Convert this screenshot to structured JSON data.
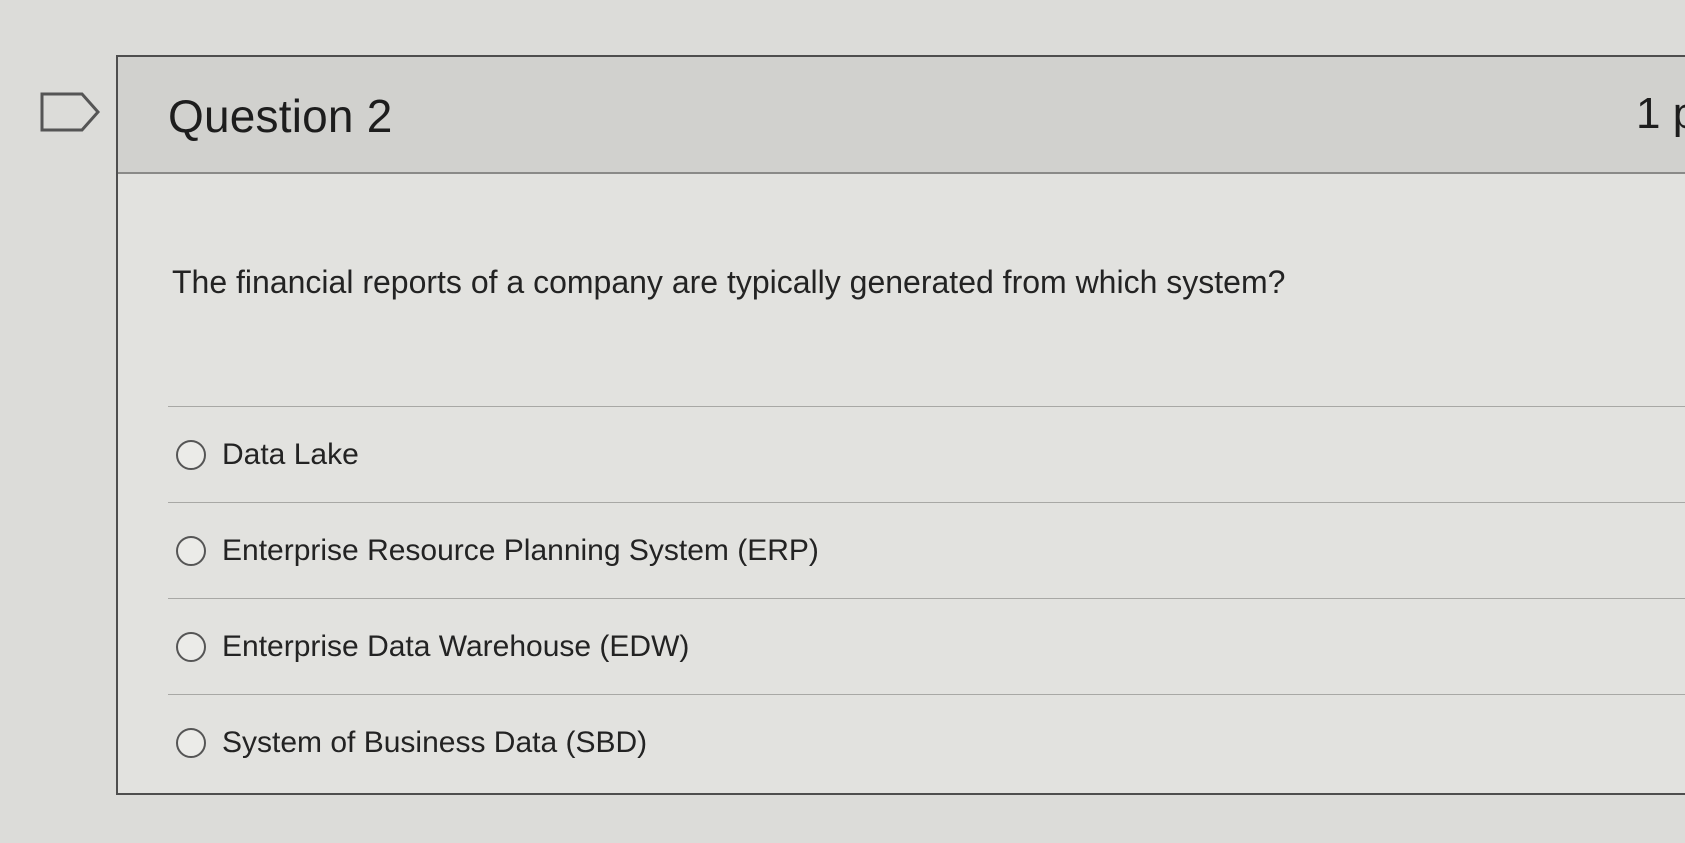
{
  "question": {
    "title": "Question 2",
    "points": "1 p",
    "text": "The financial reports of a company are typically generated from which system?",
    "answers": [
      {
        "label": "Data Lake"
      },
      {
        "label": "Enterprise Resource Planning System (ERP)"
      },
      {
        "label": "Enterprise Data Warehouse (EDW)"
      },
      {
        "label": "System of Business Data (SBD)"
      }
    ]
  },
  "icons": {
    "flag": "flag-icon"
  }
}
